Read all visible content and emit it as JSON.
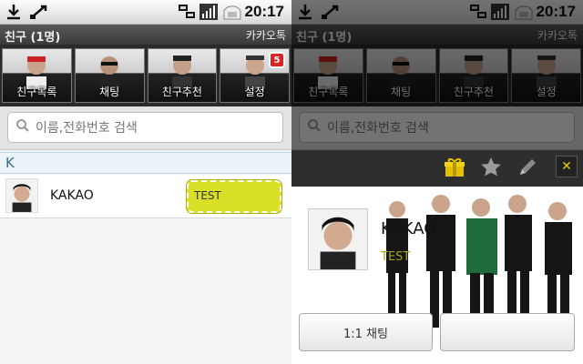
{
  "status": {
    "time": "20:17",
    "icons": [
      "download-icon",
      "usb-icon",
      "network-icon",
      "signal-icon",
      "battery-icon"
    ]
  },
  "title": {
    "left": "친구 (1명)",
    "right": "카카오톡"
  },
  "tabs": [
    {
      "label": "친구목록",
      "badge": ""
    },
    {
      "label": "채팅",
      "badge": ""
    },
    {
      "label": "친구추천",
      "badge": ""
    },
    {
      "label": "설정",
      "badge": "5"
    }
  ],
  "search": {
    "placeholder": "이름,전화번호 검색"
  },
  "section": {
    "letter": "K"
  },
  "friend": {
    "name": "KAKAO",
    "status": "TEST"
  },
  "profile": {
    "name": "KAKAO",
    "status": "TEST",
    "chat_button": "1:1 채팅",
    "second_button": ""
  },
  "popup_tools": [
    "gift-icon",
    "star-icon",
    "edit-icon"
  ],
  "colors": {
    "accent": "#d9e027",
    "title_bar": "#444444",
    "badge": "#dd2222"
  }
}
